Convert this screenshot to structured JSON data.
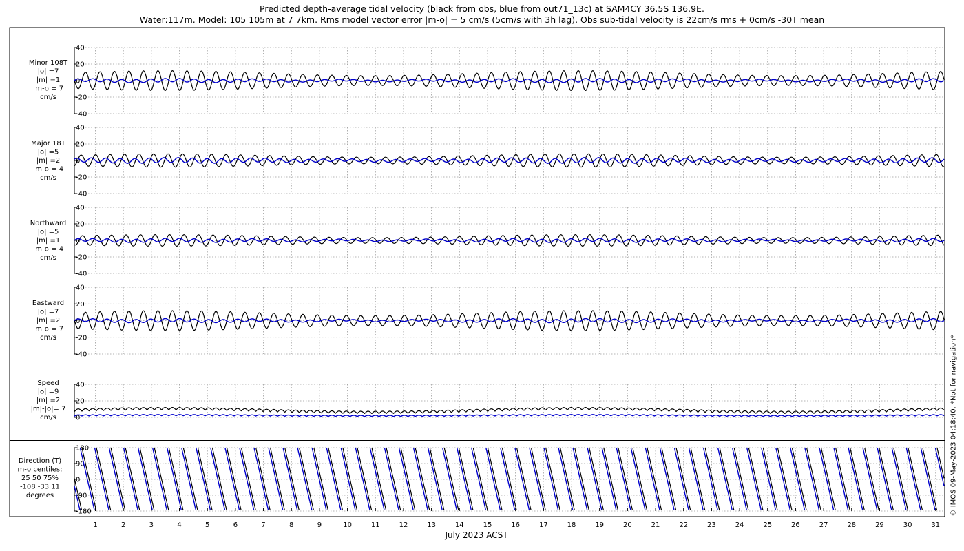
{
  "title": {
    "line1": "Predicted depth-average tidal velocity (black from obs, blue from out71_13c) at SAM4CY 36.5S 136.9E.",
    "line2": "Water:117m. Model: 105 105m at 7 7km. Rms model vector error |m-o| = 5 cm/s (5cm/s with 3h lag). Obs sub-tidal velocity is 22cm/s rms + 0cm/s -30T mean"
  },
  "copyright": "© IMOS 09-May-2023 04:18:40. *Not for navigation*",
  "colors": {
    "obs": "#000000",
    "model": "#0000cc",
    "grid": "#9a9a9a"
  },
  "chart_data": [
    {
      "type": "line",
      "panel": "Minor 108T",
      "label_lines": [
        "Minor 108T",
        "|o| =7",
        "|m| =1",
        "|m-o|= 7",
        "cm/s"
      ],
      "ylim": [
        -40,
        40
      ],
      "yticks": [
        "40",
        "20",
        "0",
        "-20",
        "-40"
      ],
      "ytick_values": [
        40,
        20,
        0,
        -20,
        -40
      ],
      "series": [
        {
          "color": "black",
          "amplitude": 12,
          "phase": 0.0
        },
        {
          "color": "blue",
          "amplitude": 2,
          "phase": 0.5
        }
      ]
    },
    {
      "type": "line",
      "panel": "Major 18T",
      "label_lines": [
        "Major 18T",
        "|o| =5",
        "|m| =2",
        "|m-o|= 4",
        "cm/s"
      ],
      "ylim": [
        -40,
        40
      ],
      "yticks": [
        "40",
        "20",
        "0",
        "-20",
        "-40"
      ],
      "ytick_values": [
        40,
        20,
        0,
        -20,
        -40
      ],
      "series": [
        {
          "color": "black",
          "amplitude": 8,
          "phase": 0.3
        },
        {
          "color": "blue",
          "amplitude": 3,
          "phase": 0.6
        }
      ]
    },
    {
      "type": "line",
      "panel": "Northward",
      "label_lines": [
        "Northward",
        "|o| =5",
        "|m| =1",
        "|m-o|= 4",
        "cm/s"
      ],
      "ylim": [
        -40,
        40
      ],
      "yticks": [
        "40",
        "20",
        "0",
        "-20",
        "-40"
      ],
      "ytick_values": [
        40,
        20,
        0,
        -20,
        -40
      ],
      "series": [
        {
          "color": "black",
          "amplitude": 7,
          "phase": 0.2
        },
        {
          "color": "blue",
          "amplitude": 2,
          "phase": 0.5
        }
      ]
    },
    {
      "type": "line",
      "panel": "Eastward",
      "label_lines": [
        "Eastward",
        "|o| =7",
        "|m| =2",
        "|m-o|= 7",
        "cm/s"
      ],
      "ylim": [
        -40,
        40
      ],
      "yticks": [
        "40",
        "20",
        "0",
        "-20",
        "-40"
      ],
      "ytick_values": [
        40,
        20,
        0,
        -20,
        -40
      ],
      "series": [
        {
          "color": "black",
          "amplitude": 12,
          "phase": 0.0
        },
        {
          "color": "blue",
          "amplitude": 2,
          "phase": 0.5
        }
      ]
    },
    {
      "type": "line",
      "panel": "Speed",
      "label_lines": [
        "Speed",
        "|o| =9",
        "|m| =2",
        "|m|-|o|= 7",
        "cm/s"
      ],
      "ylim": [
        0,
        40
      ],
      "yticks": [
        "40",
        "20",
        "0"
      ],
      "ytick_values": [
        40,
        20,
        0
      ],
      "series": [
        {
          "color": "black",
          "mean": 9,
          "amplitude": 3
        },
        {
          "color": "blue",
          "mean": 2,
          "amplitude": 1.5
        }
      ]
    },
    {
      "type": "line",
      "panel": "Direction (T)",
      "label_lines": [
        "Direction (T)",
        "m-o centiles:",
        "25  50  75%",
        "-108  -33  11",
        "degrees"
      ],
      "ylim": [
        -180,
        180
      ],
      "yticks": [
        "180",
        "90",
        "0",
        "-90",
        "-180"
      ],
      "ytick_values": [
        180,
        90,
        0,
        -90,
        -180
      ],
      "series": [
        {
          "color": "black"
        },
        {
          "color": "blue"
        }
      ]
    }
  ],
  "x_axis": {
    "label": "July 2023 ACST",
    "ticks": [
      "1",
      "2",
      "3",
      "4",
      "5",
      "6",
      "7",
      "8",
      "9",
      "10",
      "11",
      "12",
      "13",
      "14",
      "15",
      "16",
      "17",
      "18",
      "19",
      "20",
      "21",
      "22",
      "23",
      "24",
      "25",
      "26",
      "27",
      "28",
      "29",
      "30",
      "31"
    ],
    "range_days": [
      0.25,
      31.3
    ]
  }
}
